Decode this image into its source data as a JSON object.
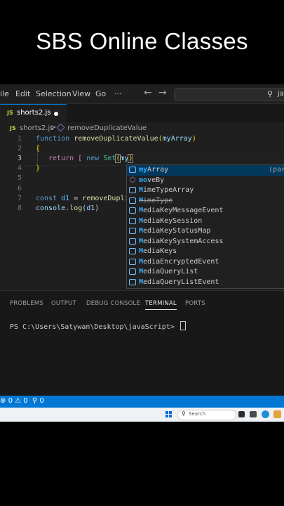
{
  "banner": {
    "title": "SBS Online Classes"
  },
  "menubar": {
    "items": [
      "ile",
      "Edit",
      "Selection",
      "View",
      "Go",
      "···"
    ],
    "search_text": "ja"
  },
  "tab": {
    "badge": "JS",
    "label": "shorts2.js"
  },
  "breadcrumb": {
    "badge": "JS",
    "file": "shorts2.js",
    "separator": ">",
    "function": "removeDuplicateValue"
  },
  "editor": {
    "line_numbers": [
      "1",
      "2",
      "3",
      "4",
      "5",
      "6",
      "7",
      "8"
    ],
    "lines": {
      "l1_kw": "function",
      "l1_fn": "removeDuplicateValue",
      "l1_open": "(",
      "l1_param": "myArray",
      "l1_close": ")",
      "l2": "{",
      "l3_kw": "return",
      "l3_bracket": "[",
      "l3_new": "new",
      "l3_cls": "Set",
      "l3_open": "(",
      "l3_typed": "my",
      "l3_close": ")",
      "l4": "}",
      "l6_kw": "const",
      "l6_var": "d1",
      "l6_eq": "=",
      "l6_fn": "removeDupli",
      "l8_obj": "console",
      "l8_dot": ".",
      "l8_fn": "log",
      "l8_arg": "(d1)"
    }
  },
  "suggestions": {
    "items": [
      {
        "match": "my",
        "rest": "Array",
        "detail": "(para"
      },
      {
        "match": "mo",
        "rest": "veBy"
      },
      {
        "match": "M",
        "rest": "imeTypeArray"
      },
      {
        "match": "M",
        "rest": "imeType"
      },
      {
        "match": "M",
        "rest": "ediaKeyMessageEvent"
      },
      {
        "match": "M",
        "rest": "ediaKeySession"
      },
      {
        "match": "M",
        "rest": "ediaKeyStatusMap"
      },
      {
        "match": "M",
        "rest": "ediaKeySystemAccess"
      },
      {
        "match": "M",
        "rest": "ediaKeys"
      },
      {
        "match": "M",
        "rest": "ediaEncryptedEvent"
      },
      {
        "match": "M",
        "rest": "ediaQueryList"
      },
      {
        "match": "M",
        "rest": "ediaQueryListEvent"
      }
    ]
  },
  "panel": {
    "tabs": [
      "PROBLEMS",
      "OUTPUT",
      "DEBUG CONSOLE",
      "TERMINAL",
      "PORTS"
    ],
    "active_tab": "TERMINAL",
    "terminal_prompt": "PS C:\\Users\\Satywan\\Desktop\\javaScript>"
  },
  "statusbar": {
    "errors": "0",
    "warnings": "0",
    "ports": "0"
  },
  "taskbar": {
    "search_label": "Search"
  },
  "colors": {
    "accent": "#0078d4",
    "statusbar": "#0078d4",
    "editor_bg": "#1f1f1f",
    "selection": "#04395e"
  }
}
